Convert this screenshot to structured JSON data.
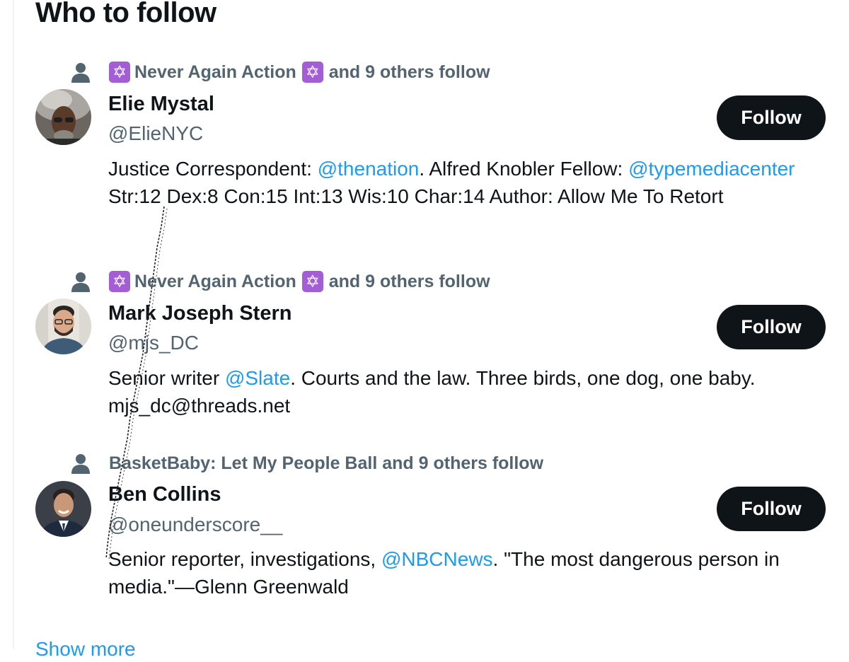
{
  "header": {
    "title": "Who to follow"
  },
  "suggestions": [
    {
      "social_prefix": "Never Again Action",
      "social_suffix": "and 9 others follow",
      "has_star_badges": true,
      "name": "Elie Mystal",
      "handle": "@ElieNYC",
      "bio_parts": [
        "Justice Correspondent: ",
        "@thenation",
        ". Alfred Knobler Fellow: ",
        "@typemediacenter",
        " Str:12 Dex:8 Con:15 Int:13 Wis:10 Char:14 Author: Allow Me To Retort"
      ],
      "follow_label": "Follow"
    },
    {
      "social_prefix": "Never Again Action",
      "social_suffix": "and 9 others follow",
      "has_star_badges": true,
      "name": "Mark Joseph Stern",
      "handle": "@mjs_DC",
      "bio_parts": [
        "Senior writer ",
        "@Slate",
        ". Courts and the law. Three birds, one dog, one baby. mjs_dc@threads.net"
      ],
      "follow_label": "Follow"
    },
    {
      "social_text": "BasketBaby: Let My People Ball and 9 others follow",
      "has_star_badges": false,
      "name": "Ben Collins",
      "handle": "@oneunderscore__",
      "bio_parts": [
        "Senior reporter, investigations, ",
        "@NBCNews",
        ". \"The most dangerous person in media.\"—Glenn Greenwald"
      ],
      "follow_label": "Follow"
    }
  ],
  "footer": {
    "show_more_label": "Show more"
  },
  "icons": {
    "follower": "person-icon",
    "badge": "star-of-david-icon",
    "badge_glyph": "✡"
  },
  "colors": {
    "text_primary": "#0f1419",
    "text_secondary": "#536471",
    "link": "#1d9bf0",
    "button_bg": "#0f1419",
    "badge_bg": "#a35ed6"
  }
}
